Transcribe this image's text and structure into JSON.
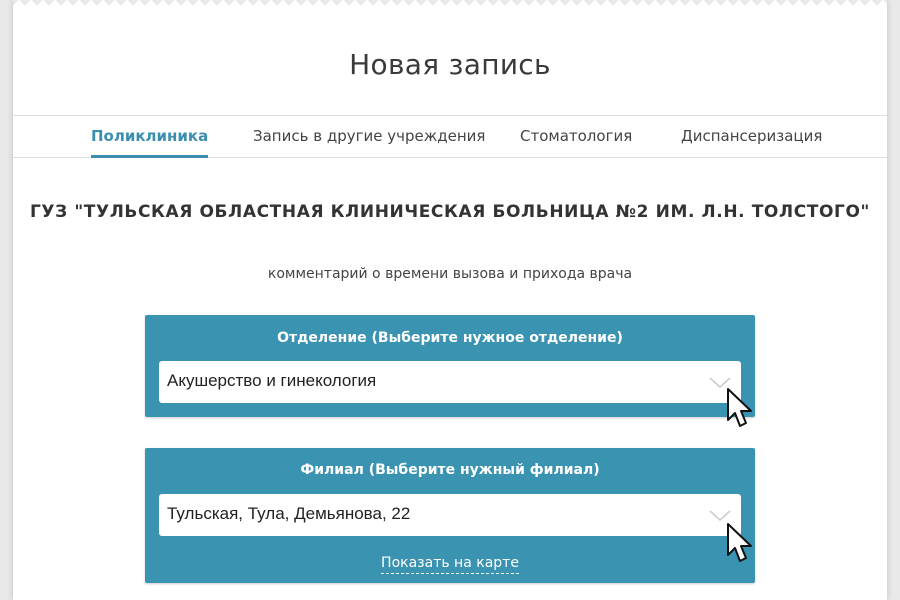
{
  "page": {
    "title": "Новая запись"
  },
  "tabs": [
    {
      "label": "Поликлиника",
      "active": true
    },
    {
      "label": "Запись в другие учреждения"
    },
    {
      "label": "Стоматология"
    },
    {
      "label": "Диспансеризация"
    }
  ],
  "organization": "ГУЗ \"ТУЛЬСКАЯ ОБЛАСТНАЯ КЛИНИЧЕСКАЯ БОЛЬНИЦА №2 ИМ. Л.Н. ТОЛСТОГО\"",
  "comment": "комментарий о времени вызова и прихода врача",
  "department": {
    "label": "Отделение (Выберите нужное отделение)",
    "value": "Акушерство и гинекология"
  },
  "branch": {
    "label": "Филиал (Выберите нужный филиал)",
    "value": "Тульская, Тула, Демьянова, 22",
    "map_link": "Показать на карте"
  },
  "colors": {
    "accent": "#3a8fb0",
    "panel": "#3a93b0"
  },
  "icons": [
    "chevron-down-icon",
    "mouse-cursor-icon"
  ]
}
